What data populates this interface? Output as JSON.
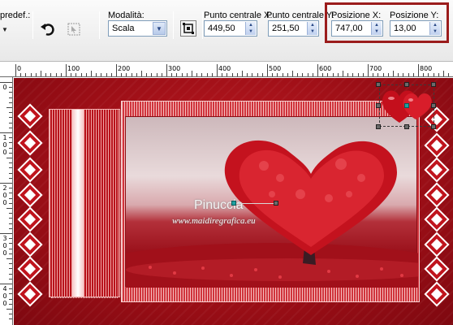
{
  "toolbar": {
    "preset_label": "predef.:",
    "mode_label": "Modalità:",
    "mode_value": "Scala",
    "center_x_label": "Punto centrale X:",
    "center_x_value": "449,50",
    "center_y_label": "Punto centrale Y:",
    "center_y_value": "251,50",
    "pos_x_label": "Posizione X:",
    "pos_x_value": "747,00",
    "pos_y_label": "Posizione Y:",
    "pos_y_value": "13,00",
    "highlight_color": "#9b1c1c"
  },
  "ruler": {
    "h_labels": [
      "0",
      "100",
      "200",
      "300",
      "400",
      "500",
      "600",
      "700",
      "800"
    ],
    "v_labels": [
      "0",
      "1 0 0",
      "2 0 0",
      "3 0 0",
      "4 0 0"
    ]
  },
  "canvas": {
    "watermark_name": "Pinuccia",
    "watermark_site": "www.maidiregrafica.eu",
    "colors": {
      "background": "#9b0e16",
      "accent": "#c01a22",
      "light": "#f5c0c0"
    }
  },
  "icons": [
    "dropdown-arrow-icon",
    "undo-icon",
    "pick-tool-icon",
    "scale-icon",
    "heart-tree-image",
    "hearts-image"
  ]
}
